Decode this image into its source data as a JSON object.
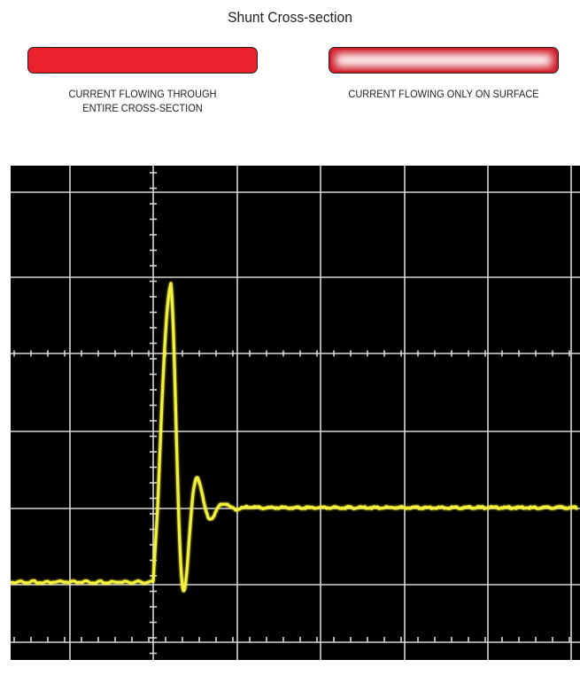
{
  "title": "Shunt Cross-section",
  "shunts": [
    {
      "caption_line1": "CURRENT FLOWING THROUGH",
      "caption_line2": "ENTIRE CROSS-SECTION",
      "fill": "#e8212d"
    },
    {
      "caption_line1": "CURRENT FLOWING ONLY ON SURFACE",
      "caption_line2": "",
      "fill": "#d11d2c"
    }
  ],
  "oscilloscope": {
    "background": "#000000",
    "grid_color": "#d8d8d8",
    "trace_color": "#f2f03c"
  }
}
